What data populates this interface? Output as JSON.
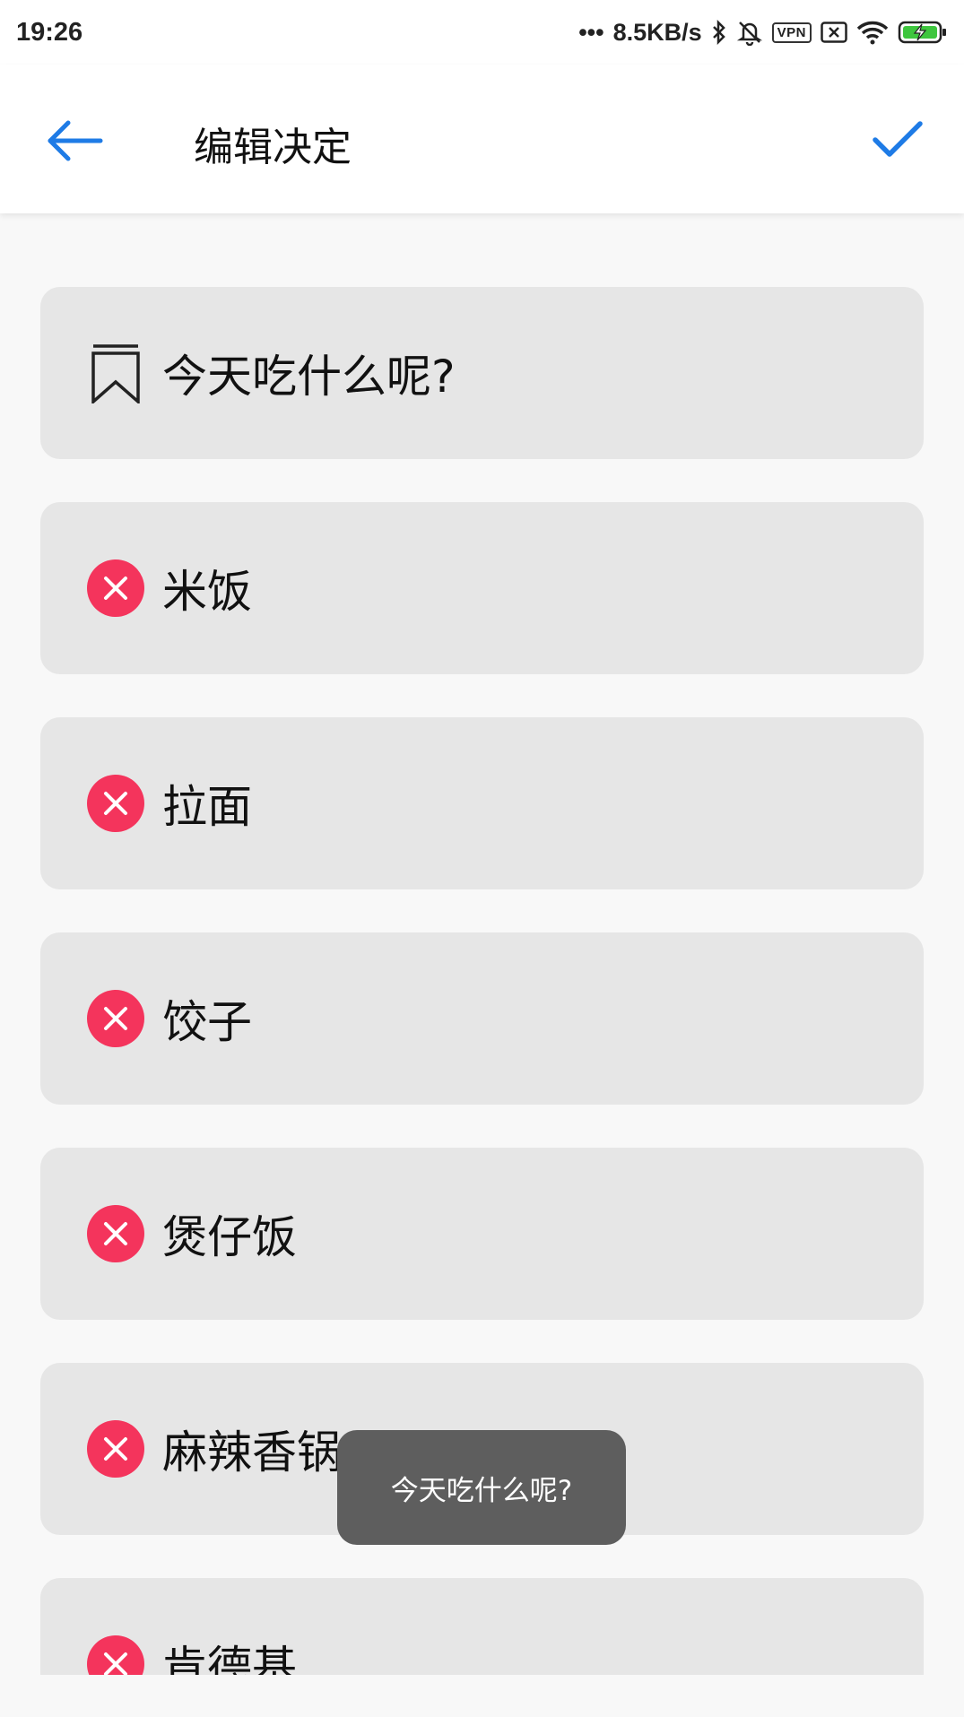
{
  "status_bar": {
    "time": "19:26",
    "net_speed": "8.5KB/s",
    "vpn_label": "VPN",
    "battery_color": "#3ec63e"
  },
  "header": {
    "title": "编辑决定",
    "accent_color": "#1e7be6"
  },
  "decision": {
    "question": "今天吃什么呢?"
  },
  "options": [
    {
      "label": "米饭"
    },
    {
      "label": "拉面"
    },
    {
      "label": "饺子"
    },
    {
      "label": "煲仔饭"
    },
    {
      "label": "麻辣香锅"
    },
    {
      "label": "肯德基"
    }
  ],
  "toast": {
    "text": "今天吃什么呢?"
  },
  "colors": {
    "remove": "#f4345c",
    "card_bg": "#e6e6e6"
  }
}
